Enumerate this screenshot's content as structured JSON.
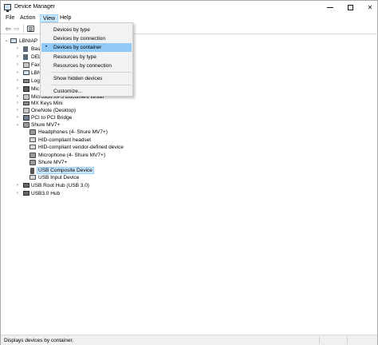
{
  "window": {
    "title": "Device Manager"
  },
  "menu": {
    "file": "File",
    "action": "Action",
    "view": "View",
    "help": "Help"
  },
  "view_menu": {
    "items": [
      {
        "label": "Devices by type"
      },
      {
        "label": "Devices by connection"
      },
      {
        "label": "Devices by container",
        "checked_mark": "•"
      },
      {
        "label": "Resources by type"
      },
      {
        "label": "Resources by connection"
      },
      {
        "label": "Show hidden devices"
      },
      {
        "label": "Customize..."
      }
    ]
  },
  "tree": {
    "root": "LBNIAP",
    "nodes": [
      {
        "label": "Bas",
        "expander": "›",
        "icon": "generic-icon"
      },
      {
        "label": "DEL",
        "expander": "›",
        "icon": "generic-icon"
      },
      {
        "label": "Fax",
        "expander": "›",
        "icon": "printer-icon"
      },
      {
        "label": "LBN",
        "expander": "›",
        "icon": "computer-icon"
      },
      {
        "label": "Log",
        "expander": "›",
        "icon": "keyboard-icon"
      },
      {
        "label": "Mic",
        "expander": "›",
        "icon": "chip-icon"
      },
      {
        "label": "Microsoft XPS Document Writer",
        "expander": "›",
        "icon": "printer-icon"
      },
      {
        "label": "MX Keys Mini",
        "expander": "›",
        "icon": "keyboard-icon"
      },
      {
        "label": "OneNote (Desktop)",
        "expander": "›",
        "icon": "printer-icon"
      },
      {
        "label": "PCI to PCI Bridge",
        "expander": "›",
        "icon": "pci-icon"
      },
      {
        "label": "Shure MV7+",
        "expander": "⌄",
        "icon": "speaker-icon"
      },
      {
        "label": "Headphones (4- Shure MV7+)",
        "child": true,
        "icon": "speaker-icon"
      },
      {
        "label": "HID-compliant headset",
        "child": true,
        "icon": "hid-icon"
      },
      {
        "label": "HID-compliant vendor-defined device",
        "child": true,
        "icon": "hid-icon"
      },
      {
        "label": "Microphone (4- Shure MV7+)",
        "child": true,
        "icon": "speaker-icon"
      },
      {
        "label": "Shure MV7+",
        "child": true,
        "icon": "speaker-icon"
      },
      {
        "label": "USB Composite Device",
        "child": true,
        "icon": "usb-icon",
        "selected": true
      },
      {
        "label": "USB Input Device",
        "child": true,
        "icon": "hid-icon"
      },
      {
        "label": "USB Root Hub (USB 3.0)",
        "expander": "›",
        "icon": "hub-icon"
      },
      {
        "label": "USB3.0 Hub",
        "expander": "›",
        "icon": "hub-icon"
      }
    ]
  },
  "status": {
    "text": "Displays devices by container."
  },
  "colors": {
    "menu_highlight": "#91c9f7",
    "selection": "#cce8ff"
  }
}
